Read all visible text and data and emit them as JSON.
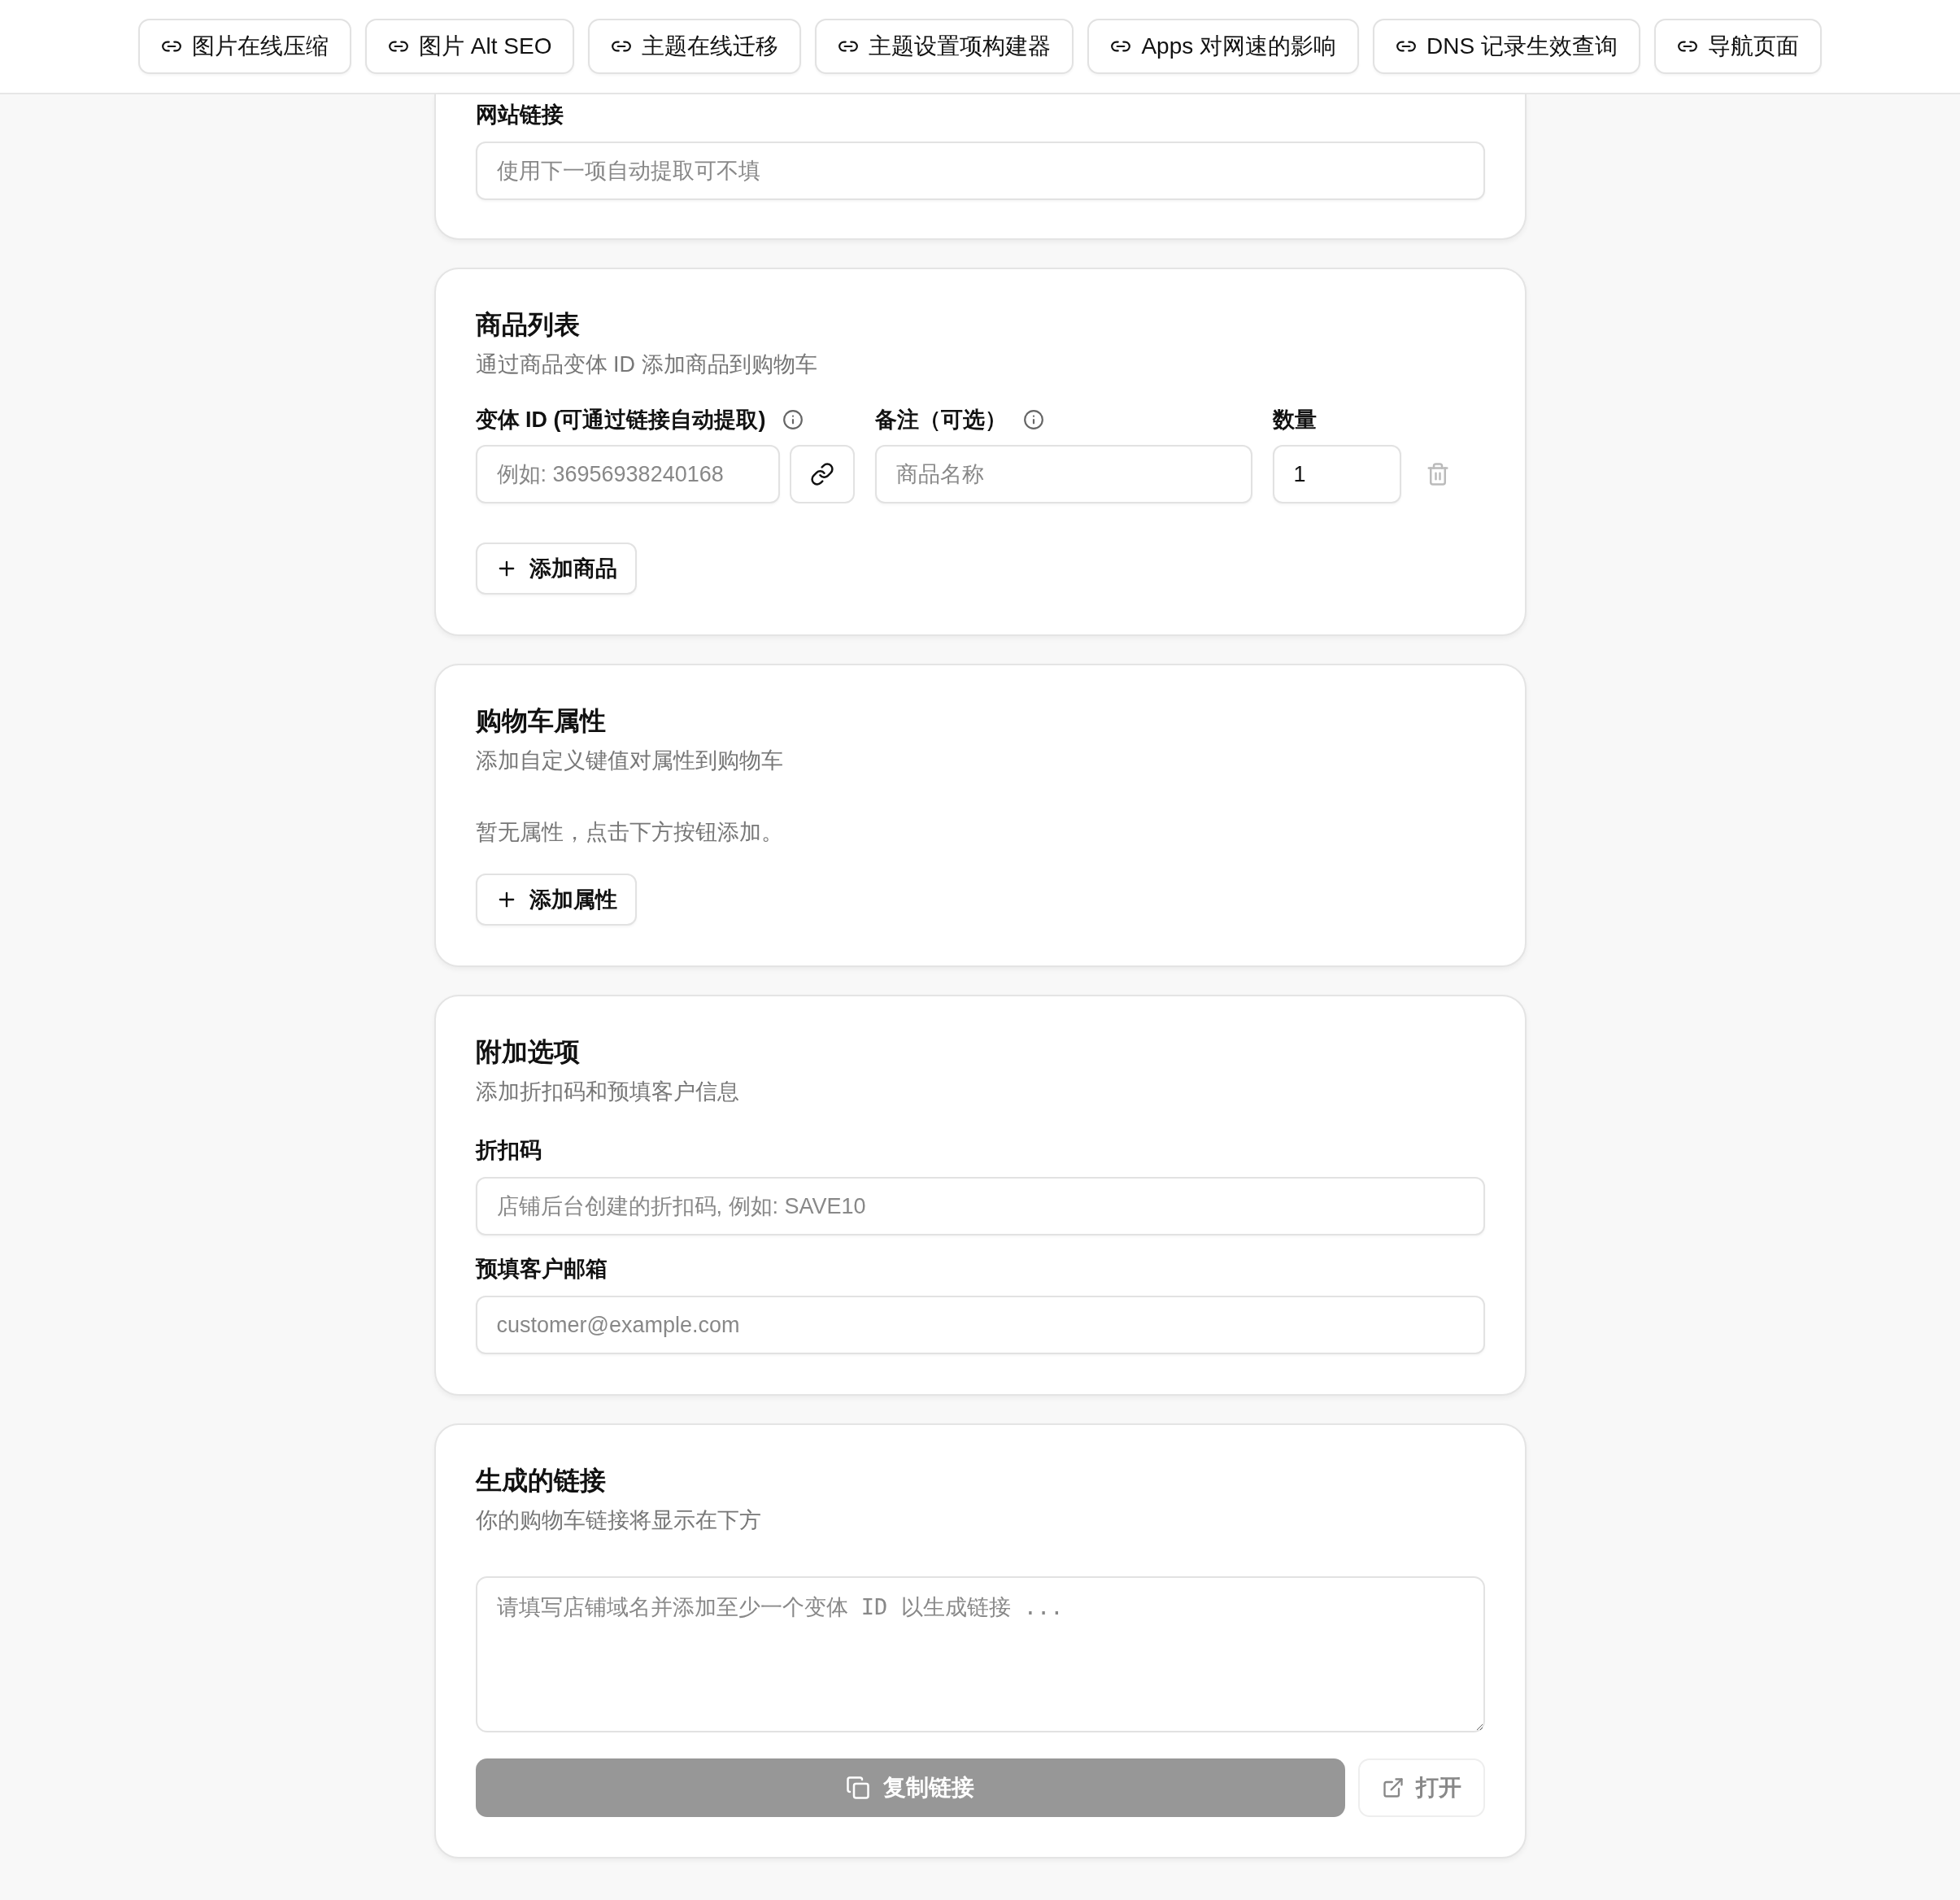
{
  "nav": [
    {
      "label": "图片在线压缩"
    },
    {
      "label": "图片 Alt SEO"
    },
    {
      "label": "主题在线迁移"
    },
    {
      "label": "主题设置项构建器"
    },
    {
      "label": "Apps 对网速的影响"
    },
    {
      "label": "DNS 记录生效查询"
    },
    {
      "label": "导航页面"
    }
  ],
  "sections": [
    {
      "kind": "fields",
      "fields": [
        {
          "label": "网站链接",
          "placeholder": "使用下一项自动提取可不填"
        }
      ]
    },
    {
      "kind": "products",
      "title": "商品列表",
      "subtitle": "通过商品变体 ID 添加商品到购物车",
      "columns": [
        {
          "label": "变体 ID (可通过链接自动提取)",
          "info": true
        },
        {
          "label": "备注（可选）",
          "info": true
        },
        {
          "label": "数量",
          "info": false
        }
      ],
      "rows": [
        {
          "variant_placeholder": "例如: 36956938240168",
          "note_placeholder": "商品名称",
          "quantity": "1"
        }
      ],
      "add_button": "添加商品"
    },
    {
      "kind": "attributes",
      "title": "购物车属性",
      "subtitle": "添加自定义键值对属性到购物车",
      "empty_text": "暂无属性，点击下方按钮添加。",
      "add_button": "添加属性"
    },
    {
      "kind": "fields",
      "title": "附加选项",
      "subtitle": "添加折扣码和预填客户信息",
      "fields": [
        {
          "label": "折扣码",
          "placeholder": "店铺后台创建的折扣码, 例如: SAVE10"
        },
        {
          "label": "预填客户邮箱",
          "placeholder": "customer@example.com"
        }
      ]
    },
    {
      "kind": "output",
      "title": "生成的链接",
      "subtitle": "你的购物车链接将显示在下方",
      "placeholder": "请填写店铺域名并添加至少一个变体 ID 以生成链接 ...",
      "copy_button": {
        "label": "复制链接",
        "disabled": true
      },
      "open_button": {
        "label": "打开",
        "disabled": true
      }
    }
  ]
}
